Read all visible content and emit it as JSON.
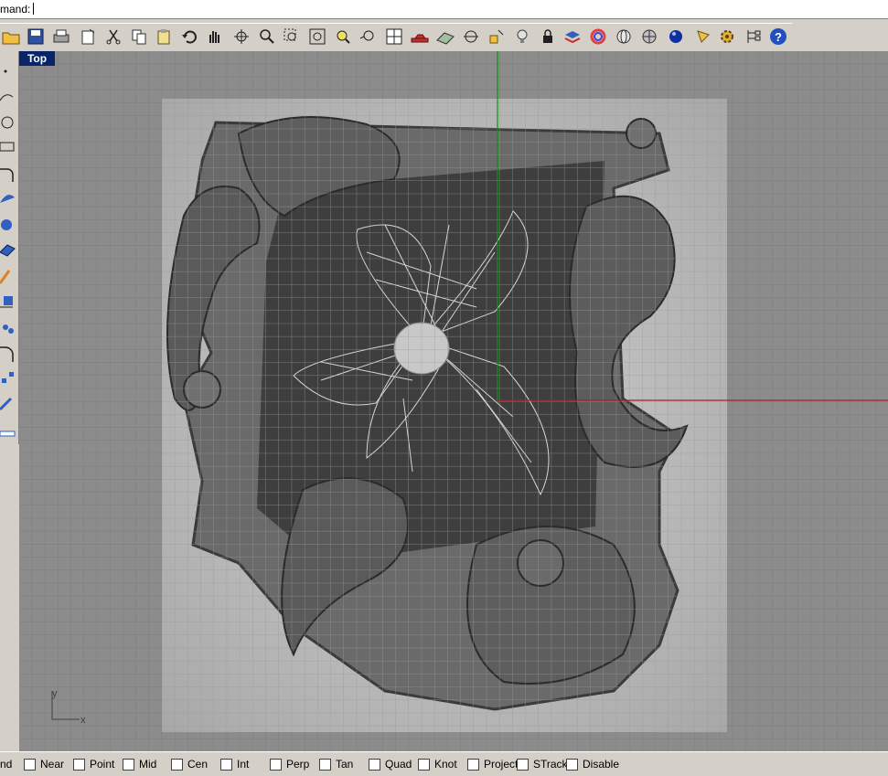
{
  "command": {
    "prompt": "mand:",
    "value": ""
  },
  "viewport": {
    "label": "Top",
    "bg": "#8c8c8c",
    "image_bg": "#b9b9b9"
  },
  "axis": {
    "y": "y",
    "x": "x"
  },
  "toolbar_icons": [
    "open-icon",
    "save-icon",
    "print-icon",
    "properties-icon",
    "cut-icon",
    "copy-icon",
    "paste-icon",
    "undo-icon",
    "pan-icon",
    "rotate-view-icon",
    "zoom-icon",
    "zoom-window-icon",
    "zoom-extents-icon",
    "zoom-selected-icon",
    "undo-view-icon",
    "viewports-icon",
    "car-icon",
    "grid-icon",
    "osnap-icon",
    "lights-icon",
    "bulb-icon",
    "lock-icon",
    "layer-icon",
    "color-wheel-icon",
    "globe-icon",
    "mesh-sphere-icon",
    "render-sphere-icon",
    "spotlight-icon",
    "gear-icon",
    "tree-icon",
    "help-icon"
  ],
  "left_tools": [
    "point-icon",
    "curve-icon",
    "circle-icon",
    "rectangle-icon",
    "arc-icon",
    "surface-icon",
    "solid-icon",
    "mesh-icon",
    "edit-icon",
    "dimension-icon",
    "transform-icon",
    "fillet-icon",
    "array-icon",
    "measure-icon",
    "ruler-icon"
  ],
  "snaps": [
    {
      "label": "nd",
      "checkbox": false
    },
    {
      "label": "Near",
      "checkbox": true
    },
    {
      "label": "Point",
      "checkbox": true
    },
    {
      "label": "Mid",
      "checkbox": true
    },
    {
      "label": "Cen",
      "checkbox": true
    },
    {
      "label": "Int",
      "checkbox": true
    },
    {
      "label": "Perp",
      "checkbox": true
    },
    {
      "label": "Tan",
      "checkbox": true
    },
    {
      "label": "Quad",
      "checkbox": true
    },
    {
      "label": "Knot",
      "checkbox": true
    },
    {
      "label": "Project",
      "checkbox": true
    },
    {
      "label": "STrack",
      "checkbox": true
    },
    {
      "label": "Disable",
      "checkbox": true
    }
  ]
}
